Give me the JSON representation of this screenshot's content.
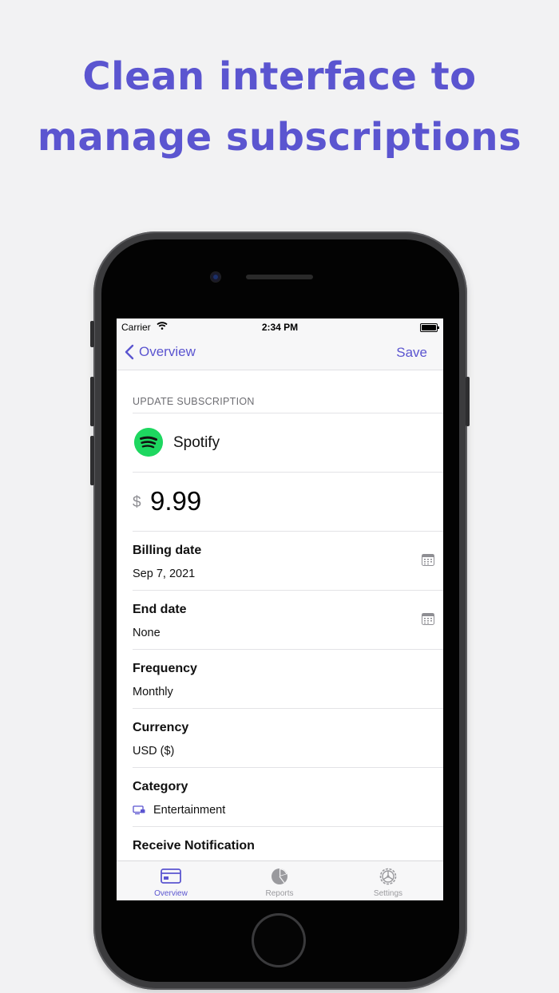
{
  "headline": {
    "line1": "Clean interface to",
    "line2": "manage subscriptions"
  },
  "status_bar": {
    "carrier": "Carrier",
    "time": "2:34 PM"
  },
  "nav": {
    "back_label": "Overview",
    "save_label": "Save"
  },
  "form": {
    "section_header": "UPDATE SUBSCRIPTION",
    "app_name": "Spotify",
    "currency_symbol": "$",
    "price": "9.99",
    "fields": [
      {
        "label": "Billing date",
        "value": "Sep 7, 2021"
      },
      {
        "label": "End date",
        "value": "None"
      },
      {
        "label": "Frequency",
        "value": "Monthly"
      },
      {
        "label": "Currency",
        "value": "USD ($)"
      },
      {
        "label": "Category",
        "value": "Entertainment"
      },
      {
        "label": "Receive Notification",
        "value": ""
      }
    ]
  },
  "tabs": [
    {
      "label": "Overview",
      "icon": "card-icon",
      "active": true
    },
    {
      "label": "Reports",
      "icon": "pie-chart-icon",
      "active": false
    },
    {
      "label": "Settings",
      "icon": "gear-icon",
      "active": false
    }
  ],
  "colors": {
    "accent": "#5b55d0",
    "spotify_green": "#1ed760",
    "background": "#f2f2f3"
  }
}
